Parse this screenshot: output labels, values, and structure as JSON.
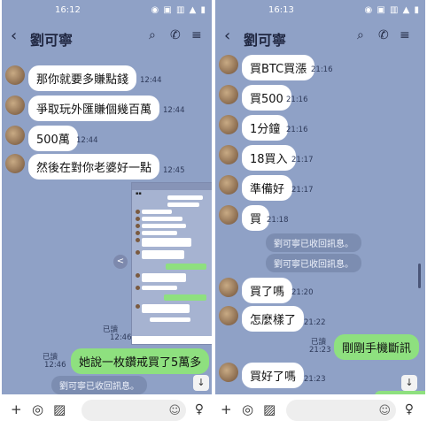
{
  "left": {
    "status_time": "16:12",
    "status_icons": "◉ ▣ ▥ ▲ ▮",
    "title": "劉可寧",
    "messages": [
      {
        "text": "那你就要多賺點錢",
        "time": "12:44"
      },
      {
        "text": "爭取玩外匯賺個幾百萬",
        "time": "12:44"
      },
      {
        "text": "500萬",
        "time": "12:44"
      },
      {
        "text": "然後在對你老婆好一點",
        "time": "12:45"
      }
    ],
    "screenshot_time": "12:46",
    "screenshot_read": "已讀",
    "sent": {
      "text": "她說一枚鑽戒買了5萬多",
      "read": "已讀",
      "time": "12:46"
    },
    "system": "劉可寧已收回訊息。"
  },
  "right": {
    "status_time": "16:13",
    "status_icons": "◉ ▣ ▥ ▲ ▮",
    "title": "劉可寧",
    "messages_a": [
      {
        "text": "買BTC買漲",
        "time": "21:16"
      },
      {
        "text": "買500",
        "time": "21:16"
      },
      {
        "text": "1分鐘",
        "time": "21:16"
      },
      {
        "text": "18買入",
        "time": "21:17"
      },
      {
        "text": "準備好",
        "time": "21:17"
      },
      {
        "text": "買",
        "time": "21:18"
      }
    ],
    "system_1": "劉可寧已收回訊息。",
    "system_2": "劉可寧已收回訊息。",
    "messages_b": [
      {
        "text": "買了嗎",
        "time": "21:20"
      },
      {
        "text": "怎麼樣了",
        "time": "21:22"
      }
    ],
    "sent": {
      "text": "剛剛手機斷訊",
      "read": "已讀",
      "time": "21:23"
    },
    "last": {
      "text": "買好了嗎",
      "time": "21:23"
    }
  },
  "icons": {
    "back": "‹",
    "search": "⌕",
    "phone": "✆",
    "menu": "≡",
    "plus": "+",
    "camera": "◎",
    "image": "▨",
    "emoji": "☺",
    "mic": "♀",
    "scroll_down": "↓",
    "share": "<"
  },
  "colors": {
    "chat_background": "#8fa1c6",
    "sent_bubble": "#8ee07f",
    "received_bubble": "#ffffff"
  }
}
